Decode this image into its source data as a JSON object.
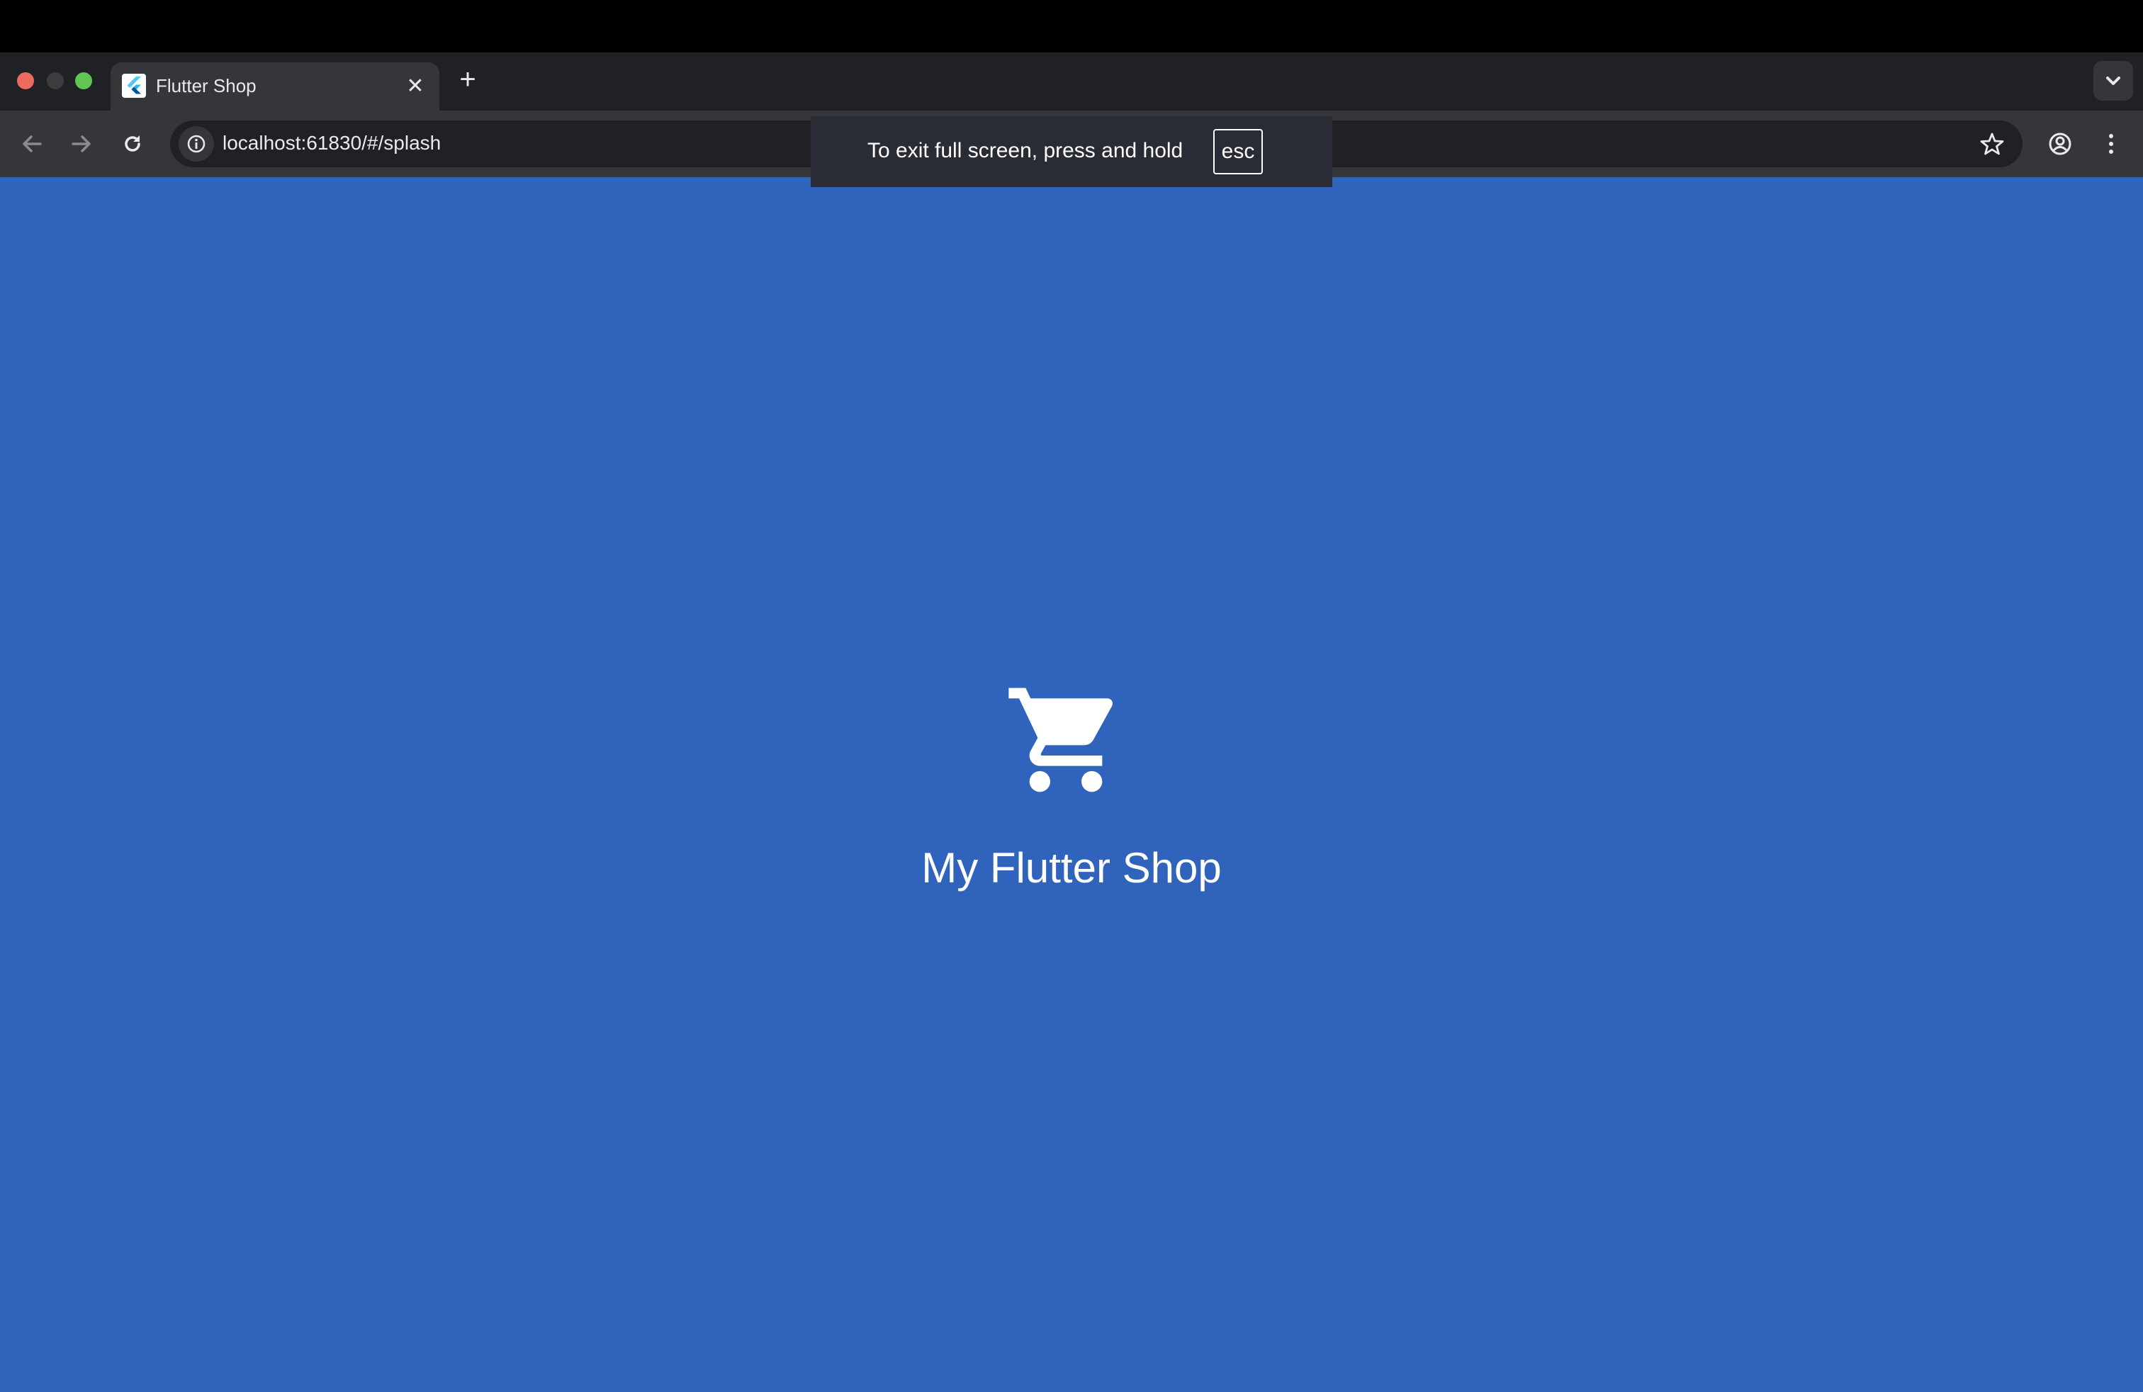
{
  "browser": {
    "tab": {
      "title": "Flutter Shop",
      "close_glyph": "✕"
    },
    "new_tab_glyph": "+",
    "url": "localhost:61830/#/splash",
    "icons": [
      "back-icon",
      "forward-icon",
      "reload-icon",
      "info-icon",
      "star-icon",
      "profile-icon",
      "menu-icon",
      "tab-search-icon",
      "flutter-logo-icon"
    ]
  },
  "fullscreen_notice": {
    "text": "To exit full screen, press and hold",
    "key": "esc"
  },
  "app": {
    "title": "My Flutter Shop",
    "icon": "shopping-cart-icon",
    "background_color": "#3064bc",
    "foreground_color": "#ffffff"
  },
  "colors": {
    "close_button": "#ed6a5e",
    "minimize_button": "#3c3c3e",
    "maximize_button": "#61c554",
    "tab_strip": "#202124",
    "toolbar": "#35363a"
  }
}
